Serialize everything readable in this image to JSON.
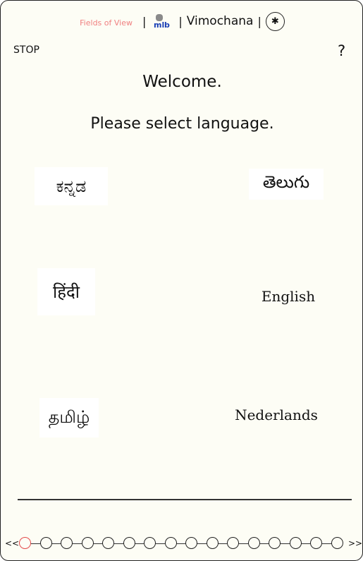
{
  "header": {
    "fields_of_view": "Fields of View",
    "sep": "|",
    "mlb_logo": "ml-b",
    "org": "Vimochana",
    "emblem": "✱"
  },
  "toolbar": {
    "stop_label": "STOP",
    "help_label": "?"
  },
  "main": {
    "welcome": "Welcome.",
    "prompt": "Please select language.",
    "languages": [
      "ಕನ್ನಡ",
      "తెలుగు",
      "हिंदी",
      "English",
      "தமிழ்",
      "Nederlands"
    ]
  },
  "pager": {
    "prev": "<<",
    "next": ">>",
    "total_steps": 16,
    "current_step": 1,
    "accent": "#e34b4b"
  }
}
